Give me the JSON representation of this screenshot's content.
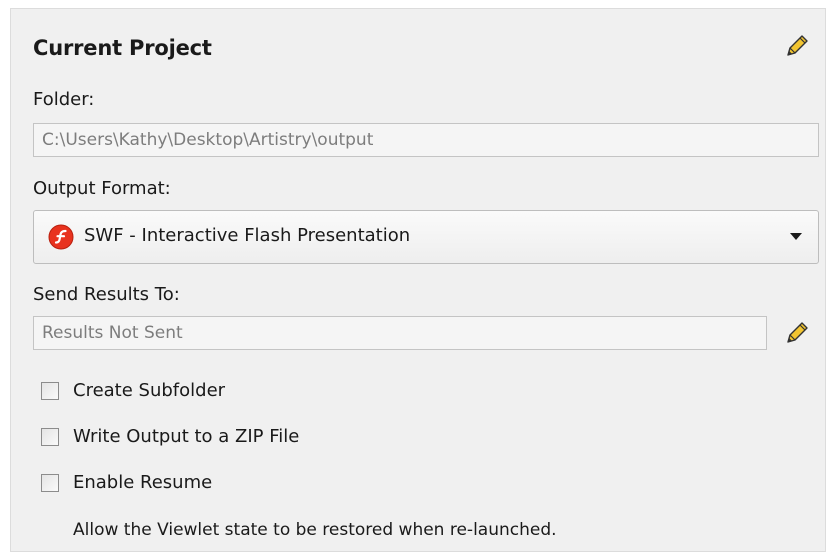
{
  "panel": {
    "title": "Current Project",
    "edit_icon": "pencil-icon"
  },
  "folder": {
    "label": "Folder:",
    "value": "C:\\Users\\Kathy\\Desktop\\Artistry\\output"
  },
  "output_format": {
    "label": "Output Format:",
    "selected": "SWF - Interactive Flash Presentation",
    "icon": "flash-icon",
    "icon_color": "#e8321e"
  },
  "send_results": {
    "label": "Send Results To:",
    "value": "Results Not Sent",
    "edit_icon": "pencil-icon"
  },
  "options": [
    {
      "label": "Create Subfolder",
      "checked": false
    },
    {
      "label": "Write Output to a ZIP File",
      "checked": false
    },
    {
      "label": "Enable Resume",
      "checked": false
    }
  ],
  "enable_resume_hint": "Allow the Viewlet state to be restored when re-launched.",
  "colors": {
    "panel_background": "#f0f0f0",
    "pencil_fill": "#f2c531"
  }
}
